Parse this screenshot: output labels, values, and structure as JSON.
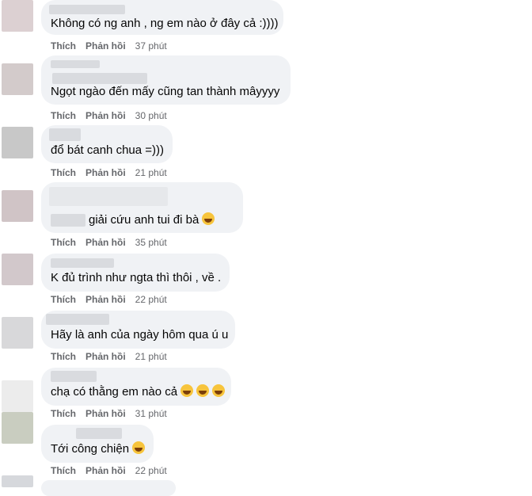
{
  "actions": {
    "like": "Thích",
    "reply": "Phản hồi"
  },
  "comments": [
    {
      "text": "Không có ng anh , ng em nào ở đây cả :))))",
      "time": "37 phút"
    },
    {
      "text": "Ngọt ngào đến mấy cũng tan thành mâyyyy",
      "time": "30 phút"
    },
    {
      "text": "đổ bát canh chua =)))",
      "time": "21 phút"
    },
    {
      "text": "giải cứu anh tui đi bà",
      "time": "35 phút",
      "emoji": [
        "rolling-on-floor-laughing-icon"
      ]
    },
    {
      "text": "K đủ trình như ngta thì thôi , về .",
      "time": "22 phút"
    },
    {
      "text": "Hãy là anh của ngày hôm qua ú u",
      "time": "21 phút"
    },
    {
      "text": "chạ có thằng em nào cả",
      "time": "31 phút",
      "emoji": [
        "laughing-tears-icon",
        "laughing-tears-icon",
        "laughing-tears-icon"
      ]
    },
    {
      "text": "Tới công chiện",
      "time": "22 phút",
      "emoji": [
        "crying-face-icon"
      ]
    }
  ]
}
